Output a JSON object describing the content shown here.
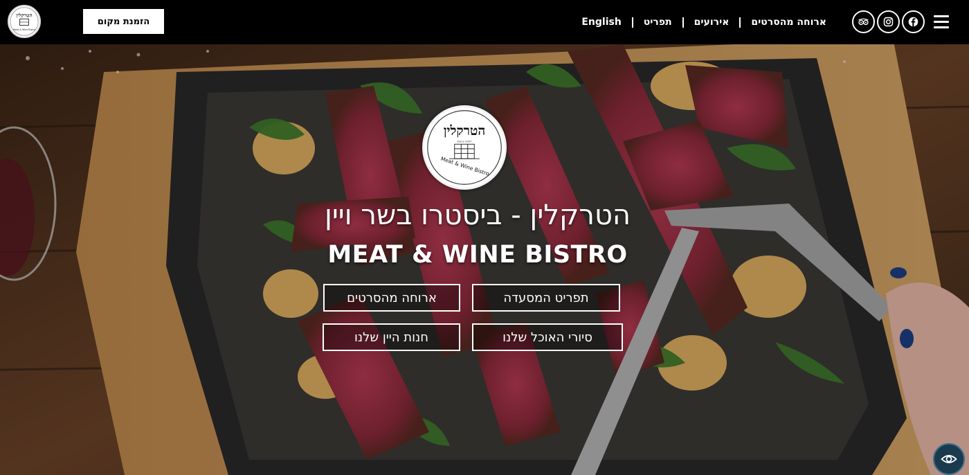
{
  "header": {
    "logo_alt": "הטרקלין Meat & Wine Bistro",
    "reserve_label": "הזמנת מקום",
    "nav": [
      {
        "label": "ארוחה מהסרטים"
      },
      {
        "label": "אירועים"
      },
      {
        "label": "תפריט"
      },
      {
        "label": "English"
      }
    ],
    "social": [
      "facebook-icon",
      "instagram-icon",
      "tripadvisor-icon"
    ],
    "menu_icon": "hamburger-menu-icon"
  },
  "hero": {
    "logo": {
      "hebrew": "הטרקלין",
      "english": "Meat & Wine Bistro",
      "since": "Since 2007"
    },
    "title": "הטרקלין - ביסטרו בשר ויין",
    "subtitle": "MEAT & WINE BISTRO",
    "buttons": {
      "menu": "תפריט המסעדה",
      "movie_dinner": "ארוחה מהסרטים",
      "food_tours": "סיורי האוכל שלנו",
      "wine_shop": "חנות היין שלנו"
    }
  },
  "accessibility": {
    "icon": "eye-icon"
  },
  "colors": {
    "header_bg": "#000000",
    "a11y_bg": "#1b3a4e",
    "text": "#ffffff"
  }
}
